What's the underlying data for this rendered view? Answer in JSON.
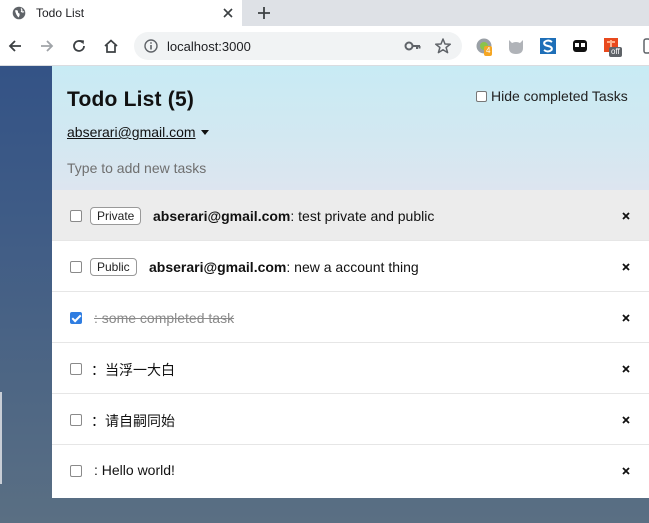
{
  "browser": {
    "tab_title": "Todo List",
    "url": "localhost:3000",
    "ext_badge_1": "4",
    "ext_badge_6": "off"
  },
  "app": {
    "title": "Todo List (5)",
    "hide_completed_label": "Hide completed Tasks",
    "hide_completed_checked": false,
    "account": "abserari@gmail.com",
    "new_task_placeholder": "Type to add new tasks"
  },
  "tasks": [
    {
      "privacy": "Private",
      "owner": "abserari@gmail.com",
      "sep": ": ",
      "text": "test private and public",
      "checked": false,
      "highlighted": true
    },
    {
      "privacy": "Public",
      "owner": "abserari@gmail.com",
      "sep": ": ",
      "text": "new a account thing",
      "checked": false,
      "highlighted": false
    },
    {
      "privacy": "",
      "owner": "",
      "sep": ": ",
      "text": "some completed task",
      "checked": true,
      "highlighted": false
    },
    {
      "privacy": "",
      "owner": "",
      "sep": "：",
      "text": "当浮一大白",
      "checked": false,
      "highlighted": false
    },
    {
      "privacy": "",
      "owner": "",
      "sep": "：",
      "text": "请自嗣同始",
      "checked": false,
      "highlighted": false
    },
    {
      "privacy": "",
      "owner": "",
      "sep": ": ",
      "text": "Hello world!",
      "checked": false,
      "highlighted": false
    }
  ],
  "colors": {
    "accent": "#2f7de1",
    "header_bg": "#c8ebf4"
  }
}
